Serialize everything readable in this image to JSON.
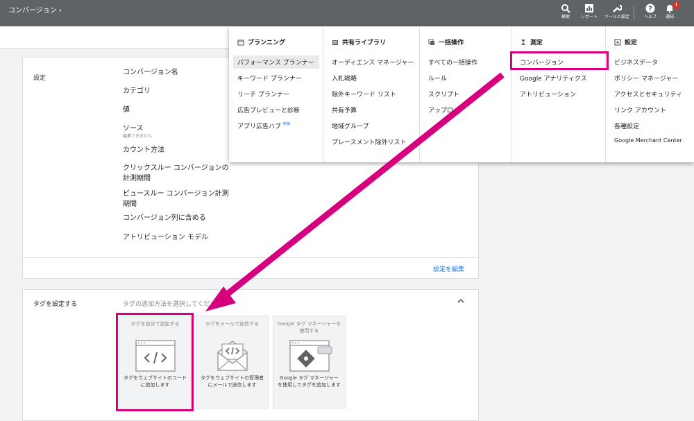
{
  "breadcrumb": "コンバージョン",
  "topbar": {
    "search": "検索",
    "reports": "レポート",
    "tools": "ツールと設定",
    "help": "ヘルプ",
    "notifications": "通知",
    "notif_count": "!"
  },
  "settings_card": {
    "title": "設定",
    "rows": [
      {
        "label": "コンバージョン名"
      },
      {
        "label": "カテゴリ"
      },
      {
        "label": "値"
      },
      {
        "label": "ソース",
        "sub": "編集できません"
      },
      {
        "label": "カウント方法"
      },
      {
        "label": "クリックスルー コンバージョンの計測期間"
      },
      {
        "label": "ビュースルー コンバージョン計測期間"
      },
      {
        "label": "コンバージョン列に含める"
      },
      {
        "label": "アトリビューション モデル"
      }
    ],
    "edit_link": "設定を編集"
  },
  "tag_card": {
    "title": "タグを設定する",
    "subtitle": "タグの追加方法を選択してください",
    "options": [
      {
        "title": "タグを自分で追加する",
        "desc": "タグをウェブサイトのコードに追加します"
      },
      {
        "title": "タグをメールで送信する",
        "desc": "タグをウェブサイトの管理者にメールで送信します"
      },
      {
        "title": "Google タグ マネージャーを使用する",
        "desc": "Google タグ マネージャーを使用してタグを追加します"
      }
    ]
  },
  "menu": {
    "planning": {
      "head": "プランニング",
      "items": [
        "パフォーマンス プランナー",
        "キーワード プランナー",
        "リーチ プランナー",
        "広告プレビューと診断",
        "アプリ広告ハブ"
      ],
      "new_badge": "新機"
    },
    "library": {
      "head": "共有ライブラリ",
      "items": [
        "オーディエンス マネージャー",
        "入札戦略",
        "除外キーワード リスト",
        "共有予算",
        "地域グループ",
        "プレースメント除外リスト"
      ]
    },
    "bulk": {
      "head": "一括操作",
      "items": [
        "すべての一括操作",
        "ルール",
        "スクリプト",
        "アップロ"
      ]
    },
    "measurement": {
      "head": "測定",
      "items": [
        "コンバージョン",
        "Google アナリティクス",
        "アトリビューション"
      ]
    },
    "setup": {
      "head": "設定",
      "items": [
        "ビジネスデータ",
        "ポリシー マネージャー",
        "アクセスとセキュリティ",
        "リンク アカウント",
        "各種設定",
        "Google Merchant Center"
      ]
    }
  },
  "colors": {
    "accent": "#d6007f",
    "topbar": "#5f6368",
    "link": "#1a73e8"
  }
}
